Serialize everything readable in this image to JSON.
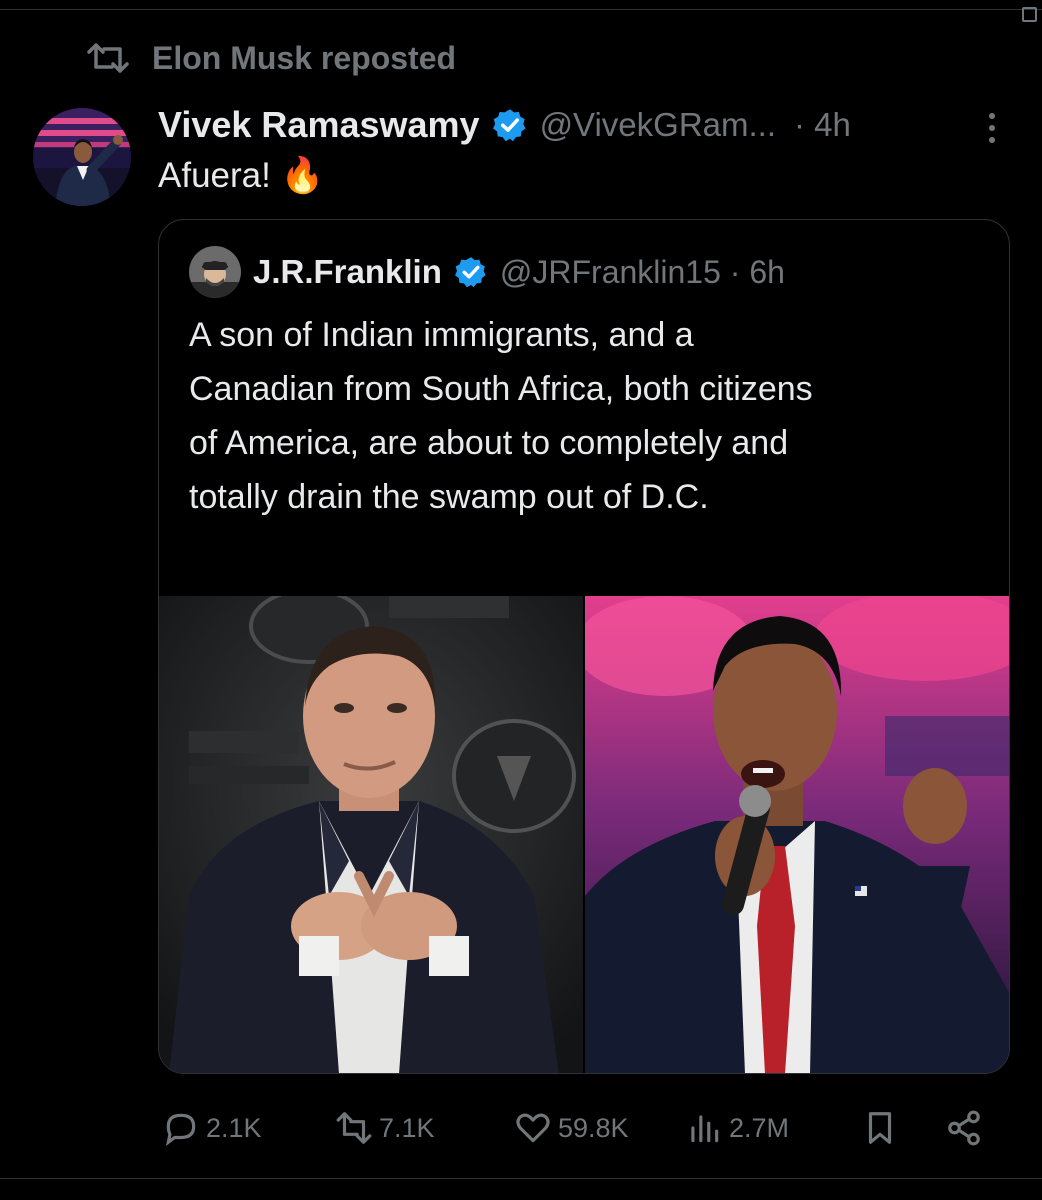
{
  "repost": {
    "label": "Elon Musk reposted",
    "icon": "repost-icon"
  },
  "tweet": {
    "author_name": "Vivek Ramaswamy",
    "author_handle": "@VivekGRam...",
    "time": "· 4h",
    "text": "Afuera!",
    "emoji": "🔥"
  },
  "quoted": {
    "author_name": "J.R.Franklin",
    "author_handle": "@JRFranklin15 · 6h",
    "text_lines": [
      "A son of Indian immigrants, and a",
      "Canadian from South Africa, both citizens",
      "of America, are about to completely and",
      "totally drain the swamp out of D.C."
    ],
    "ellipsis": "..."
  },
  "actions": {
    "replies": "2.1K",
    "reposts": "7.1K",
    "likes": "59.8K",
    "views": "2.7M"
  },
  "colors": {
    "background": "#000000",
    "text": "#e7e9ea",
    "muted": "#71767b",
    "verified": "#1d9bf0",
    "border": "#2f3336"
  }
}
